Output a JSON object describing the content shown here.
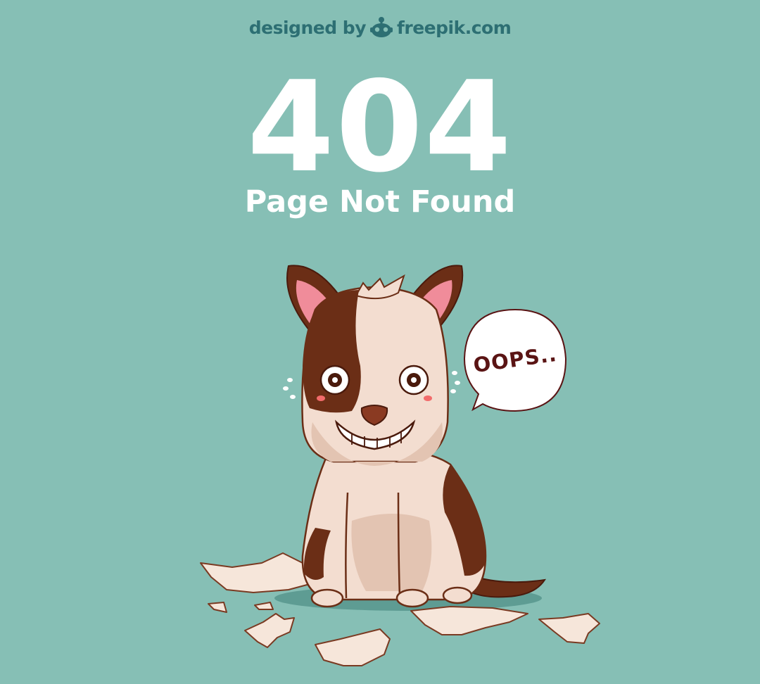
{
  "credit": {
    "prefix": "designed by",
    "brand": "freepik.com",
    "logo_icon": "freepik-robot-icon"
  },
  "error": {
    "code": "404",
    "message": "Page Not Found"
  },
  "illustration": {
    "subject": "dog-icon",
    "bubble_text": "OOPS.."
  },
  "colors": {
    "background": "#86bfb5",
    "credit_text": "#2d6f73",
    "heading_text": "#ffffff",
    "dog_brown": "#6b2e16",
    "dog_cream": "#f3ddd0",
    "bubble_text": "#5a1414"
  }
}
